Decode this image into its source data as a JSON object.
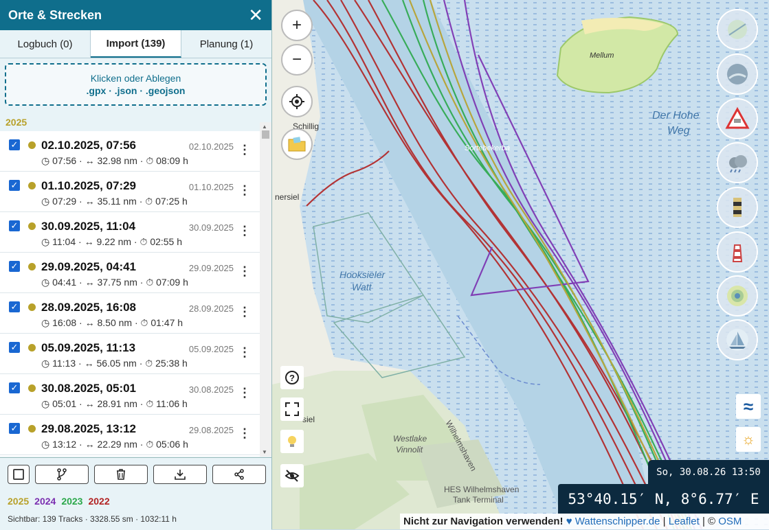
{
  "panel": {
    "title": "Orte & Strecken",
    "close_icon": "close-icon",
    "tabs": [
      {
        "label": "Logbuch (0)",
        "active": false
      },
      {
        "label": "Import (139)",
        "active": true
      },
      {
        "label": "Planung (1)",
        "active": false
      }
    ],
    "dropzone": {
      "line1": "Klicken oder Ablegen",
      "line2": ".gpx · .json · .geojson"
    },
    "year_header": "2025",
    "tracks": [
      {
        "title": "02.10.2025, 07:56",
        "date": "02.10.2025",
        "start": "07:56",
        "distance": "32.98 nm",
        "duration": "08:09 h",
        "checked": true
      },
      {
        "title": "01.10.2025, 07:29",
        "date": "01.10.2025",
        "start": "07:29",
        "distance": "35.11 nm",
        "duration": "07:25 h",
        "checked": true
      },
      {
        "title": "30.09.2025, 11:04",
        "date": "30.09.2025",
        "start": "11:04",
        "distance": "9.22 nm",
        "duration": "02:55 h",
        "checked": true
      },
      {
        "title": "29.09.2025, 04:41",
        "date": "29.09.2025",
        "start": "04:41",
        "distance": "37.75 nm",
        "duration": "07:09 h",
        "checked": true
      },
      {
        "title": "28.09.2025, 16:08",
        "date": "28.09.2025",
        "start": "16:08",
        "distance": "8.50 nm",
        "duration": "01:47 h",
        "checked": true
      },
      {
        "title": "05.09.2025, 11:13",
        "date": "05.09.2025",
        "start": "11:13",
        "distance": "56.05 nm",
        "duration": "25:38 h",
        "checked": true
      },
      {
        "title": "30.08.2025, 05:01",
        "date": "30.08.2025",
        "start": "05:01",
        "distance": "28.91 nm",
        "duration": "11:06 h",
        "checked": true
      },
      {
        "title": "29.08.2025, 13:12",
        "date": "29.08.2025",
        "start": "13:12",
        "distance": "22.29 nm",
        "duration": "05:06 h",
        "checked": true
      }
    ],
    "footer_buttons": [
      "select-all-checkbox",
      "branch-icon",
      "trash-icon",
      "download-icon",
      "share-icon"
    ],
    "years": [
      {
        "label": "2025",
        "color": "#b8a12a"
      },
      {
        "label": "2024",
        "color": "#7b2fb0"
      },
      {
        "label": "2023",
        "color": "#2ba84a"
      },
      {
        "label": "2022",
        "color": "#b22222"
      }
    ],
    "stats": "Sichtbar: 139 Tracks · 3328.55 sm · 1032:11 h"
  },
  "map": {
    "zoom_in": "+",
    "zoom_out": "−",
    "labels": {
      "mellum": "Mellum",
      "hohe_weg_1": "Der Hohe",
      "hohe_weg_2": "Weg",
      "schillig": "Schillig",
      "hooksiel_1": "Hooksieler",
      "hooksiel_2": "Watt",
      "westlake_1": "Westlake",
      "westlake_2": "Vinnolit",
      "hes_1": "HES Wilhelmshaven",
      "hes_2": "Tank Terminal",
      "wilhelmshaven": "Wilhelmshaven",
      "siel": "siel",
      "mersiel": "nersiel",
      "sortebekerbal": "Sortebekerba"
    },
    "datetime": "So, 30.08.26 13:50",
    "coordinates": "53°40.15′ N, 8°6.77′ E",
    "attribution": {
      "warning": "Nicht zur Navigation verwenden!",
      "heart": "♥",
      "site": "Wattenschipper.de",
      "sep1": "|",
      "leaflet": "Leaflet",
      "sep2": "| ©",
      "osm": "OSM"
    },
    "tide_symbol": "≈",
    "sun_symbol": "☼"
  }
}
